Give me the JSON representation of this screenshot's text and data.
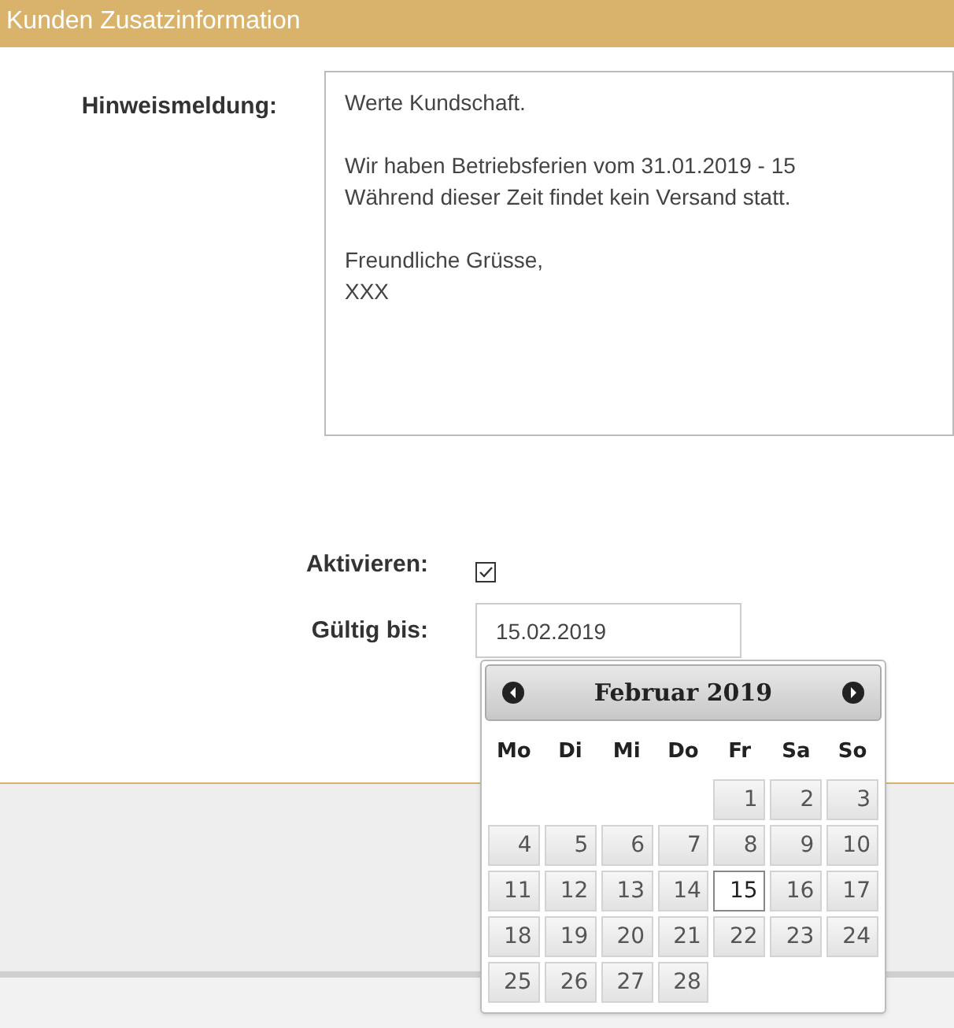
{
  "header": {
    "title": "Kunden Zusatzinformation"
  },
  "notice": {
    "label": "Hinweismeldung:",
    "value": "Werte Kundschaft.\n\nWir haben Betriebsferien vom 31.01.2019 - 15\nWährend dieser Zeit findet kein Versand statt.\n\nFreundliche Grüsse,\nXXX"
  },
  "activate": {
    "label": "Aktivieren:",
    "checked": true
  },
  "valid_until": {
    "label": "Gültig bis:",
    "value": "15.02.2019"
  },
  "datepicker": {
    "month": "Februar 2019",
    "weekdays": [
      "Mo",
      "Di",
      "Mi",
      "Do",
      "Fr",
      "Sa",
      "So"
    ],
    "days": [
      {
        "label": "1",
        "selected": false,
        "kind": "friday"
      },
      {
        "label": "2",
        "selected": false,
        "kind": "next"
      },
      {
        "label": "3",
        "selected": false,
        "kind": "next"
      },
      {
        "label": "4",
        "selected": false,
        "kind": "next"
      },
      {
        "label": "5",
        "selected": false,
        "kind": "next"
      },
      {
        "label": "6",
        "selected": false,
        "kind": "next"
      },
      {
        "label": "7",
        "selected": false,
        "kind": "next"
      },
      {
        "label": "8",
        "selected": false,
        "kind": "next"
      },
      {
        "label": "9",
        "selected": false,
        "kind": "next"
      },
      {
        "label": "10",
        "selected": false,
        "kind": "next"
      },
      {
        "label": "11",
        "selected": false,
        "kind": "next"
      },
      {
        "label": "12",
        "selected": false,
        "kind": "next"
      },
      {
        "label": "13",
        "selected": false,
        "kind": "next"
      },
      {
        "label": "14",
        "selected": false,
        "kind": "next"
      },
      {
        "label": "15",
        "selected": true,
        "kind": "next"
      },
      {
        "label": "16",
        "selected": false,
        "kind": "next"
      },
      {
        "label": "17",
        "selected": false,
        "kind": "next"
      },
      {
        "label": "18",
        "selected": false,
        "kind": "next"
      },
      {
        "label": "19",
        "selected": false,
        "kind": "next"
      },
      {
        "label": "20",
        "selected": false,
        "kind": "next"
      },
      {
        "label": "21",
        "selected": false,
        "kind": "next"
      },
      {
        "label": "22",
        "selected": false,
        "kind": "next"
      },
      {
        "label": "23",
        "selected": false,
        "kind": "next"
      },
      {
        "label": "24",
        "selected": false,
        "kind": "next"
      },
      {
        "label": "25",
        "selected": false,
        "kind": "next"
      },
      {
        "label": "26",
        "selected": false,
        "kind": "next"
      },
      {
        "label": "27",
        "selected": false,
        "kind": "next"
      },
      {
        "label": "28",
        "selected": false,
        "kind": "next"
      }
    ]
  }
}
